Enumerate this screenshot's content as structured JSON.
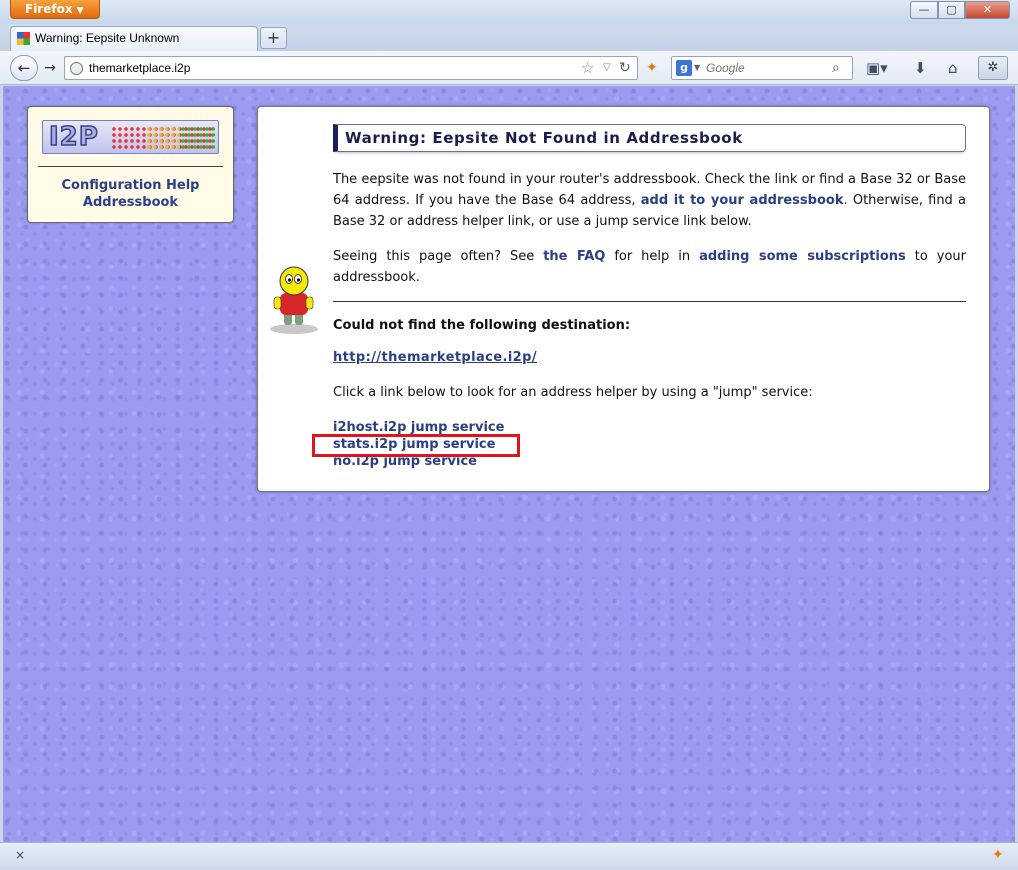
{
  "window": {
    "app_button": "Firefox",
    "minimize": "—",
    "maximize": "▢",
    "close": "✕"
  },
  "tab": {
    "title": "Warning: Eepsite Unknown",
    "new_tab": "+"
  },
  "nav": {
    "url": "themarketplace.i2p",
    "search_placeholder": "Google",
    "search_engine": "g"
  },
  "sidebar": {
    "logo_text": "I2P",
    "links": [
      "Configuration Help",
      "Addressbook"
    ]
  },
  "main": {
    "title": "Warning: Eepsite Not Found in Addressbook",
    "p1_a": "The eepsite was not found in your router's addressbook. Check the link or find a Base 32 or Base 64 address. If you have the Base 64 address, ",
    "p1_link": "add it to your addressbook",
    "p1_b": ". Otherwise, find a Base 32 or address helper link, or use a jump service link below.",
    "p2_a": "Seeing this page often? See ",
    "p2_link1": "the FAQ",
    "p2_b": " for help in ",
    "p2_link2": "adding some subscriptions",
    "p2_c": " to your addressbook.",
    "could_not_find": "Could not find the following destination:",
    "destination": "http://themarketplace.i2p/",
    "jump_intro": "Click a link below to look for an address helper by using a \"jump\" service:",
    "jump_services": [
      "i2host.i2p jump service",
      "stats.i2p jump service",
      "no.i2p jump service"
    ]
  },
  "status": {
    "close": "×"
  },
  "colors": {
    "page_background": "#9b9cf0",
    "link": "#2b3f86",
    "highlight": "#e0141c"
  }
}
